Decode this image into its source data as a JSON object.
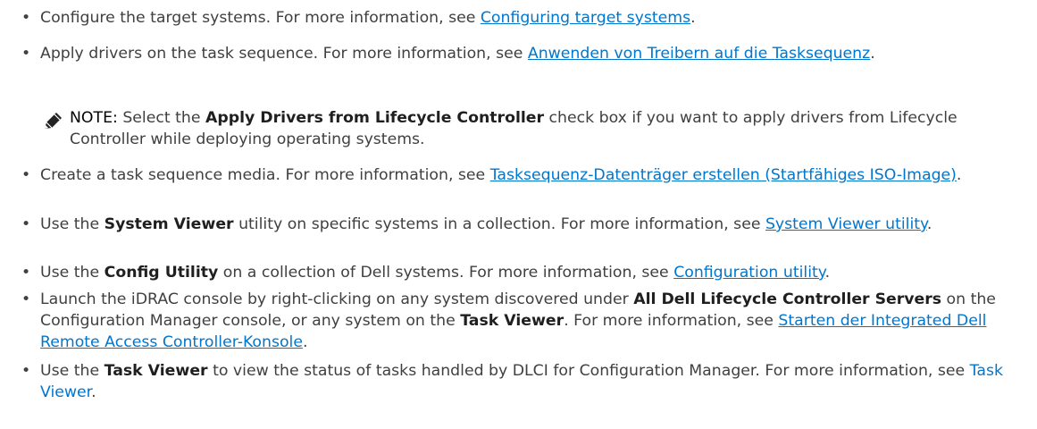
{
  "bullet_glyph": "•",
  "items": [
    {
      "prefix": "Configure the target systems. For more information, see ",
      "link": "Configuring target systems",
      "suffix": "."
    },
    {
      "prefix": "Apply drivers on the task sequence. For more information, see ",
      "link": "Anwenden von Treibern auf die Tasksequenz",
      "suffix": "."
    },
    {
      "prefix": "Create a task sequence media. For more information, see ",
      "link": "Tasksequenz-Datenträger erstellen (Startfähiges ISO-Image)",
      "suffix": "."
    },
    {
      "p1": "Use the ",
      "b1": "System Viewer",
      "p2": " utility on specific systems in a collection. For more information, see ",
      "link": "System Viewer utility",
      "suffix": "."
    },
    {
      "p1": "Use the ",
      "b1": "Config Utility",
      "p2": " on a collection of Dell systems. For more information, see ",
      "link": "Configuration utility",
      "suffix": "."
    },
    {
      "p1": "Launch the iDRAC console by right-clicking on any system discovered under ",
      "b1": "All Dell Lifecycle Controller Servers",
      "p2": " on the Configuration Manager console, or any system on the ",
      "b2": "Task Viewer",
      "p3": ". For more information, see ",
      "link": "Starten der Integrated Dell Remote Access Controller-Konsole",
      "suffix": "."
    },
    {
      "p1": "Use the ",
      "b1": "Task Viewer",
      "p2": " to view the status of tasks handled by DLCI for Configuration Manager. For more information, see ",
      "link": "Task Viewer",
      "suffix": "."
    }
  ],
  "note": {
    "label": "NOTE:",
    "p1": " Select the ",
    "b1": "Apply Drivers from Lifecycle Controller",
    "p2": " check box if you want to apply drivers from Lifecycle Controller while deploying operating systems.",
    "icon": "pencil-note-icon"
  },
  "colors": {
    "text": "#404040",
    "link": "#0076ce",
    "bold": "#1f1f1f"
  }
}
